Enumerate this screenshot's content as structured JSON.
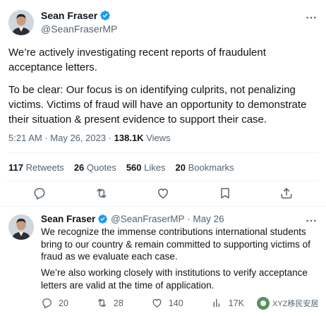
{
  "main_tweet": {
    "author_name": "Sean Fraser",
    "author_handle": "@SeanFraserMP",
    "text_paragraph_1": "We’re actively investigating recent reports of fraudulent acceptance letters.",
    "text_paragraph_2": "To be clear: Our focus is on identifying culprits, not penalizing victims. Victims of fraud will have an opportunity to demonstrate their situation & present evidence to support their case.",
    "time": "5:21 AM",
    "date": "May 26, 2023",
    "views_count": "138.1K",
    "views_label": "Views",
    "stats": {
      "retweets_count": "117",
      "retweets_label": "Retweets",
      "quotes_count": "26",
      "quotes_label": "Quotes",
      "likes_count": "560",
      "likes_label": "Likes",
      "bookmarks_count": "20",
      "bookmarks_label": "Bookmarks"
    }
  },
  "reply_tweet": {
    "author_name": "Sean Fraser",
    "author_handle": "@SeanFraserMP",
    "separator": "·",
    "date": "May 26",
    "text_paragraph_1": "We recognize the immense contributions international students bring to our country & remain committed to supporting victims of fraud as we evaluate each case.",
    "text_paragraph_2": "We’re also working closely with institutions to verify acceptance letters are valid at the time of application.",
    "actions": {
      "replies": "20",
      "retweets": "28",
      "likes": "140",
      "views": "17K"
    }
  },
  "watermark": {
    "text": "XYZ移民安居"
  },
  "colors": {
    "text_primary": "#0f1419",
    "text_secondary": "#536471",
    "verified_blue": "#1d9bf0",
    "divider": "#eff3f4"
  },
  "icons": {
    "verified": "verified-badge-icon",
    "more": "more-dots-icon",
    "reply": "reply-icon",
    "retweet": "retweet-icon",
    "like": "heart-icon",
    "bookmark": "bookmark-icon",
    "share": "share-icon",
    "views": "views-bar-icon"
  }
}
